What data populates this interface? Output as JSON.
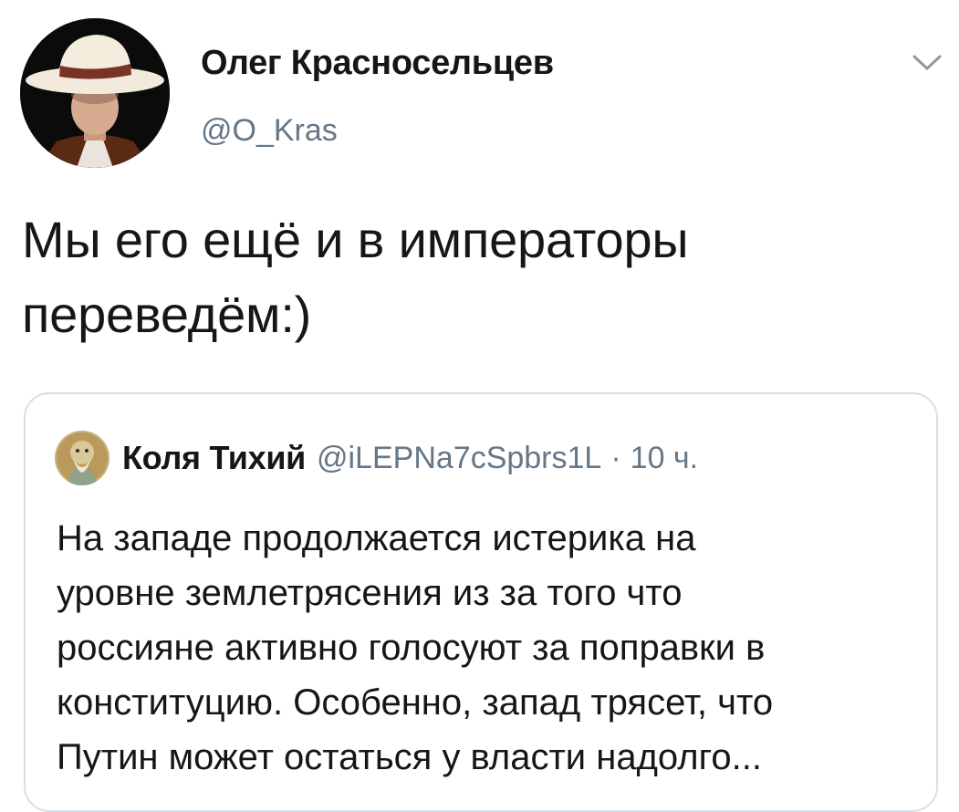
{
  "author": {
    "name": "Олег Красносельцев",
    "handle": "@O_Kras"
  },
  "tweet": {
    "text_line1": "Мы его ещё и в императоры",
    "text_line2": "переведём:)"
  },
  "quoted_tweet": {
    "name": "Коля Тихий",
    "handle": "@iLEPNa7cSpbrs1L",
    "separator": "·",
    "time": "10 ч.",
    "text_lines": [
      "На западе продолжается истерика на",
      "уровне землетрясения из за того что",
      "россияне активно голосуют за поправки в",
      "конституцию.  Особенно, запад трясет, что",
      "Путин может остаться у власти надолго..."
    ]
  },
  "icons": {
    "menu": "chevron-down-icon"
  },
  "colors": {
    "primary_text": "#14171a",
    "secondary_text": "#657786",
    "border": "#d8dfe4"
  }
}
